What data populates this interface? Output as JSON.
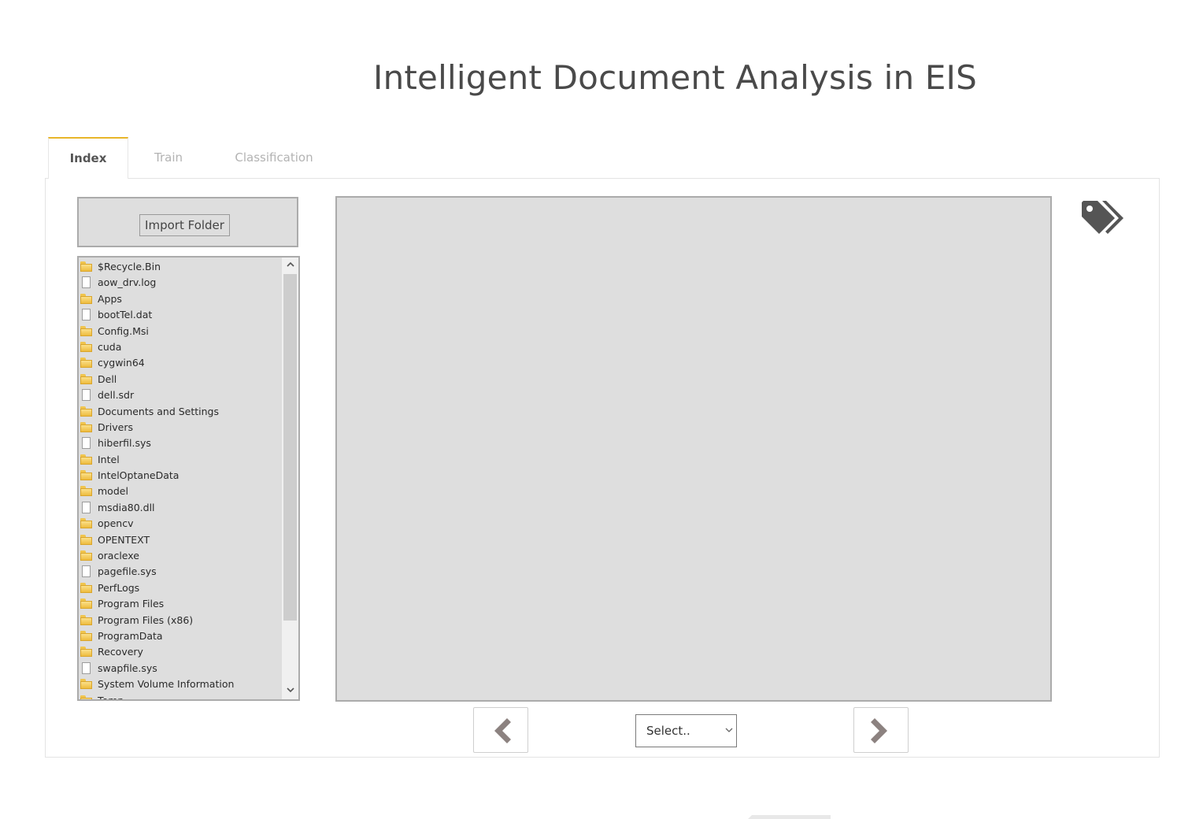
{
  "page": {
    "title": "Intelligent Document Analysis in EIS"
  },
  "tabs": [
    {
      "label": "Index",
      "active": true
    },
    {
      "label": "Train",
      "active": false
    },
    {
      "label": "Classification",
      "active": false
    }
  ],
  "sidebar": {
    "import_label": "Import Folder",
    "items": [
      {
        "label": "$Recycle.Bin",
        "type": "folder"
      },
      {
        "label": "aow_drv.log",
        "type": "file"
      },
      {
        "label": "Apps",
        "type": "folder"
      },
      {
        "label": "bootTel.dat",
        "type": "file"
      },
      {
        "label": "Config.Msi",
        "type": "folder"
      },
      {
        "label": "cuda",
        "type": "folder"
      },
      {
        "label": "cygwin64",
        "type": "folder"
      },
      {
        "label": "Dell",
        "type": "folder"
      },
      {
        "label": "dell.sdr",
        "type": "file"
      },
      {
        "label": "Documents and Settings",
        "type": "folder"
      },
      {
        "label": "Drivers",
        "type": "folder"
      },
      {
        "label": "hiberfil.sys",
        "type": "file"
      },
      {
        "label": "Intel",
        "type": "folder"
      },
      {
        "label": "IntelOptaneData",
        "type": "folder"
      },
      {
        "label": "model",
        "type": "folder"
      },
      {
        "label": "msdia80.dll",
        "type": "file"
      },
      {
        "label": "opencv",
        "type": "folder"
      },
      {
        "label": "OPENTEXT",
        "type": "folder"
      },
      {
        "label": "oraclexe",
        "type": "folder"
      },
      {
        "label": "pagefile.sys",
        "type": "file"
      },
      {
        "label": "PerfLogs",
        "type": "folder"
      },
      {
        "label": "Program Files",
        "type": "folder"
      },
      {
        "label": "Program Files (x86)",
        "type": "folder"
      },
      {
        "label": "ProgramData",
        "type": "folder"
      },
      {
        "label": "Recovery",
        "type": "folder"
      },
      {
        "label": "swapfile.sys",
        "type": "file"
      },
      {
        "label": "System Volume Information",
        "type": "folder"
      },
      {
        "label": "Temp",
        "type": "folder"
      }
    ]
  },
  "toolbar": {
    "select_value": "Select..",
    "prev_icon": "chevron-left-icon",
    "next_icon": "chevron-right-icon",
    "tag_icon": "tags-icon"
  },
  "colors": {
    "accent": "#e8b62a",
    "panel_gray": "#dedede",
    "icon_dark": "#555555",
    "nav_arrow": "#8c8280"
  }
}
